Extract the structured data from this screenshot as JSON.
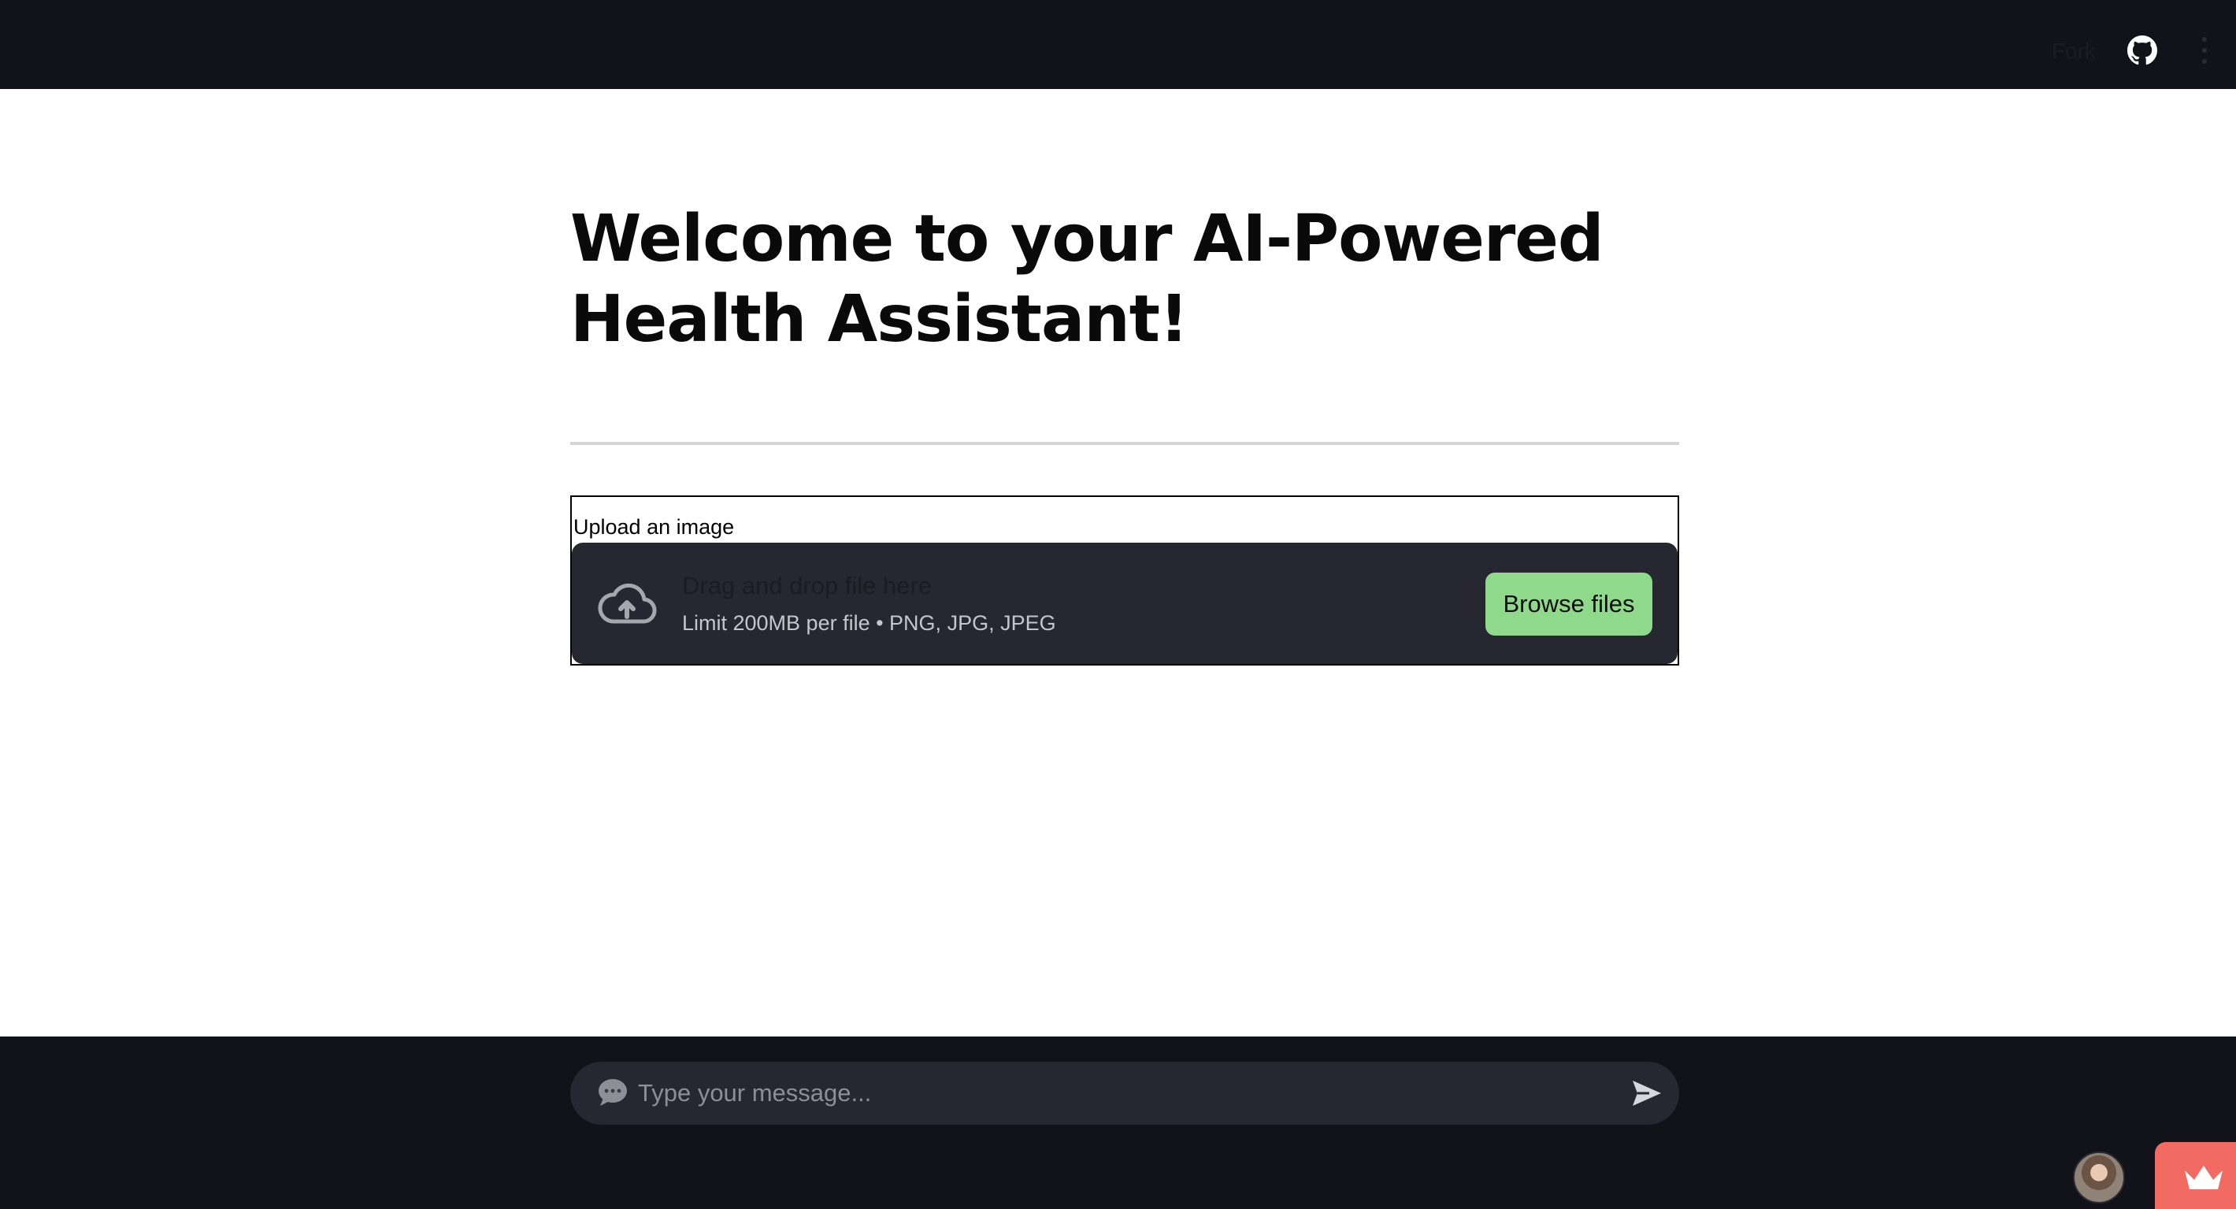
{
  "header": {
    "fork_label": "Fork",
    "github_icon": "github-icon",
    "menu_icon": "vertical-dots-menu-icon"
  },
  "main": {
    "title": "Welcome to your AI-Powered Health Assistant!"
  },
  "uploader": {
    "label": "Upload an image",
    "drop_title": "Drag and drop file here",
    "limit_text": "Limit 200MB per file • PNG, JPG, JPEG",
    "browse_label": "Browse files",
    "upload_icon": "cloud-upload-icon"
  },
  "chat": {
    "placeholder": "Type your message...",
    "bubble_icon": "speech-bubble-icon",
    "send_icon": "send-arrow-icon"
  },
  "footer": {
    "avatar": "user-avatar",
    "badge_icon": "crown-icon"
  },
  "colors": {
    "header_bg": "#121319",
    "dropzone_bg": "#262730",
    "browse_button": "#8fd98a",
    "badge": "#f16b62"
  }
}
